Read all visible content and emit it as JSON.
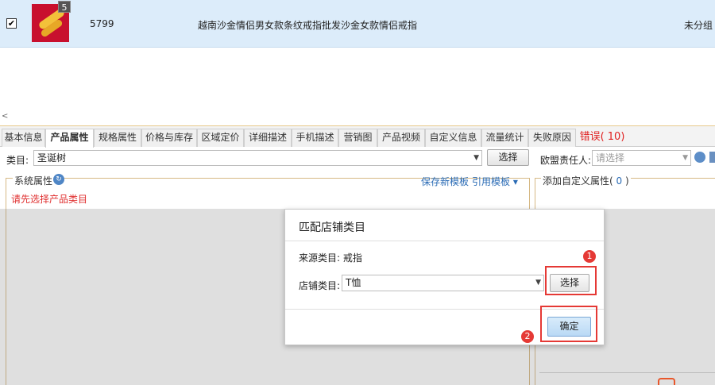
{
  "product": {
    "checkbox_mark": "✔",
    "image_count": "5",
    "id": "5799",
    "title": "越南沙金情侣男女款条纹戒指批发沙金女款情侣戒指",
    "group": "未分组"
  },
  "scroll_arrow": "<",
  "tabs": [
    {
      "label": "基本信息"
    },
    {
      "label": "产品属性"
    },
    {
      "label": "规格属性"
    },
    {
      "label": "价格与库存"
    },
    {
      "label": "区域定价"
    },
    {
      "label": "详细描述"
    },
    {
      "label": "手机描述"
    },
    {
      "label": "营销图"
    },
    {
      "label": "产品视频"
    },
    {
      "label": "自定义信息"
    },
    {
      "label": "流量统计"
    },
    {
      "label": "失败原因"
    },
    {
      "label": "错误( 10)"
    }
  ],
  "category": {
    "label": "类目:",
    "value": "圣诞树",
    "select_button": "选择",
    "responsible_label": "欧盟责任人:",
    "responsible_placeholder": "请选择"
  },
  "system_attrs": {
    "title": "系统属性",
    "save_template": "保存新模板",
    "use_template": "引用模板 ▾",
    "message": "请先选择产品类目"
  },
  "custom_attrs": {
    "title": "添加自定义属性(",
    "count": " 0 ",
    "title_end": ")"
  },
  "dialog": {
    "title": "匹配店铺类目",
    "source_label": "来源类目: 戒指",
    "store_label": "店铺类目:",
    "store_value": "T恤",
    "select_button": "选择",
    "ok_button": "确定"
  },
  "annotations": {
    "step1": "1",
    "step2": "2"
  },
  "colors": {
    "selected_row": "#dcecfa",
    "error_red": "#e02020",
    "link_blue": "#2a6bb5",
    "highlight_red": "#e53935"
  }
}
